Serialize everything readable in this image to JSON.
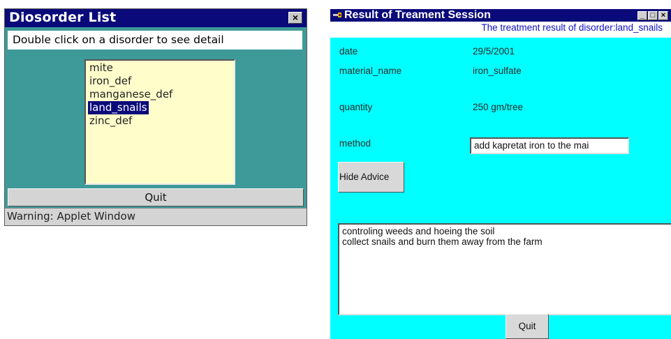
{
  "disorder_window": {
    "title": "Diosorder List",
    "close_label": "×",
    "hint": "Double click on a disorder to see detail",
    "items": [
      {
        "label": "mite",
        "selected": false
      },
      {
        "label": "iron_def",
        "selected": false
      },
      {
        "label": "manganese_def",
        "selected": false
      },
      {
        "label": "land_snails",
        "selected": true
      },
      {
        "label": "zinc_def",
        "selected": false
      }
    ],
    "quit_label": "Quit",
    "warning": "Warning: Applet Window"
  },
  "result_window": {
    "title": "Result of Treament Session",
    "minimize_label": "_",
    "maximize_label": "□",
    "close_label": "×",
    "subtitle": "The treatment result of disorder:land_snails",
    "fields": {
      "date_label": "date",
      "date_value": "29/5/2001",
      "material_label": "material_name",
      "material_value": "iron_sulfate",
      "quantity_label": "quantity",
      "quantity_value": "250 gm/tree",
      "method_label": "method",
      "method_value": "add kapretat iron to the mai"
    },
    "hide_advice_label": "Hide Advice",
    "advice_lines": [
      "controling weeds and hoeing the soil",
      "collect snails and burn them away from the farm"
    ],
    "quit_label": "Quit"
  },
  "colors": {
    "titlebar": "#0a0a7a",
    "disorder_bg": "#3d9a98",
    "result_bg": "#00ffff",
    "list_bg": "#fffecb"
  }
}
